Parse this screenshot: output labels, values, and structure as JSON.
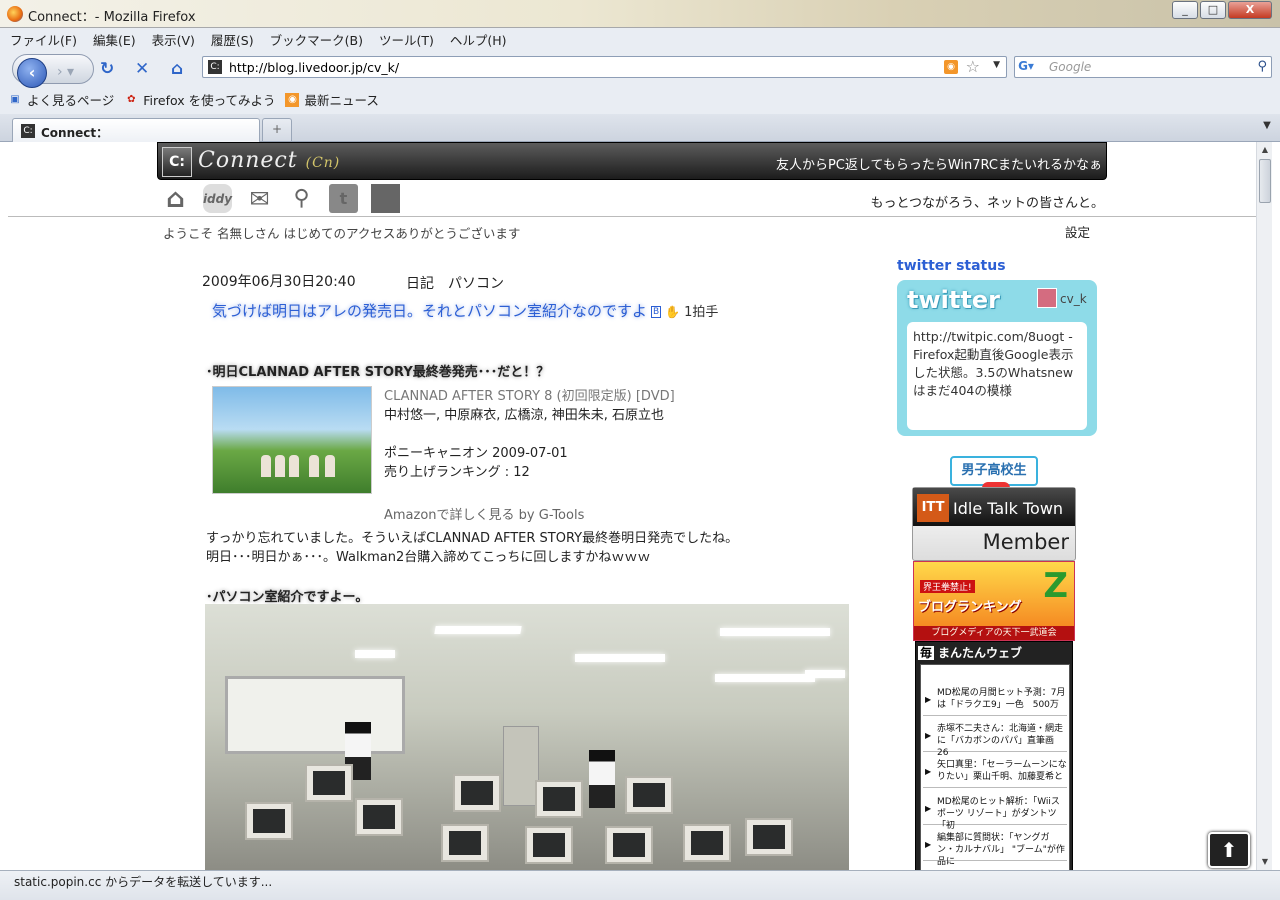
{
  "window": {
    "title": "Connect：- Mozilla Firefox",
    "controls": [
      "_",
      "□",
      "X"
    ]
  },
  "menu": [
    "ファイル(F)",
    "編集(E)",
    "表示(V)",
    "履歴(S)",
    "ブックマーク(B)",
    "ツール(T)",
    "ヘルプ(H)"
  ],
  "nav": {
    "url": "http://blog.livedoor.jp/cv_k/",
    "search_placeholder": "Google"
  },
  "bookmarks": [
    "よく見るページ",
    "Firefox を使ってみよう",
    "最新ニュース"
  ],
  "tabs": [
    {
      "label": "Connect：",
      "active": true
    }
  ],
  "status": "static.popin.cc からデータを転送しています...",
  "page": {
    "site_name": "Connect",
    "site_sub": "(Cn)",
    "header_tagline": "友人からPC返してもらったらWin7RCまたいれるかなぁ",
    "nav_icons": [
      "home-icon",
      "iddy-icon",
      "mail-icon",
      "search-icon",
      "twitter-icon",
      "itt-icon"
    ],
    "iddy_label": "iddy",
    "motto": "もっとつながろう、ネットの皆さんと。",
    "welcome": "ようこそ 名無しさん はじめてのアクセスありがとうございます",
    "settings": "設定",
    "post": {
      "date": "2009年06月30日20:40",
      "category": "日記　パソコン",
      "title": "気づけば明日はアレの発売日。それとパソコン室紹介なのですよ",
      "hatena": "B",
      "claps": "1拍手",
      "heading1": "･明日CLANNAD AFTER STORY最終巻発売･･･だと！？",
      "amazon": {
        "product": "CLANNAD AFTER STORY 8 (初回限定版) [DVD]",
        "cast": "中村悠一, 中原麻衣, 広橋涼, 神田朱未, 石原立也",
        "release": "ポニーキャニオン 2009-07-01",
        "rank": "売り上げランキング : 12",
        "link": "Amazonで詳しく見る by G-Tools"
      },
      "body_line1": "すっかり忘れていました。そういえばCLANNAD AFTER STORY最終巻明日発売でしたね。",
      "body_line2": "明日･･･明日かぁ･･･。Walkman2台購入諦めてこっちに回しますかねｗｗｗ",
      "heading2": "･パソコン室紹介ですよー。"
    },
    "sidebar": {
      "twitter_status": "twitter status",
      "twitter_logo": "twitter",
      "twitter_user": "cv_k",
      "twitter_message": "http://twitpic.com/8uogt - Firefox起動直後Google表示した状態。3.5のWhatsnewはまだ404の模様",
      "danshi": "男子高校生",
      "itt_title": "Idle Talk Town",
      "itt_sub": "Member",
      "ranking_top": "界王拳禁止!",
      "ranking_main": "ブログランキング",
      "ranking_bottom": "ブログメディアの天下一武道会",
      "mantan_title": "まんたんウェブ",
      "mantan_badge": "毎",
      "mantan_items": [
        "MD松尾の月間ヒット予測：7月は「ドラクエ9」一色　500万",
        "赤塚不二夫さん：北海道・網走に「バカボンのパパ」直筆画　26",
        "矢口真里：「セーラームーンになりたい」栗山千明、加藤夏希と",
        "MD松尾のヒット解析：「Wiiスポーツ リゾート」がダントツ 「初",
        "編集部に質問状：「ヤングガン・カルナバル」 \"ブーム\"が作品に"
      ]
    }
  }
}
